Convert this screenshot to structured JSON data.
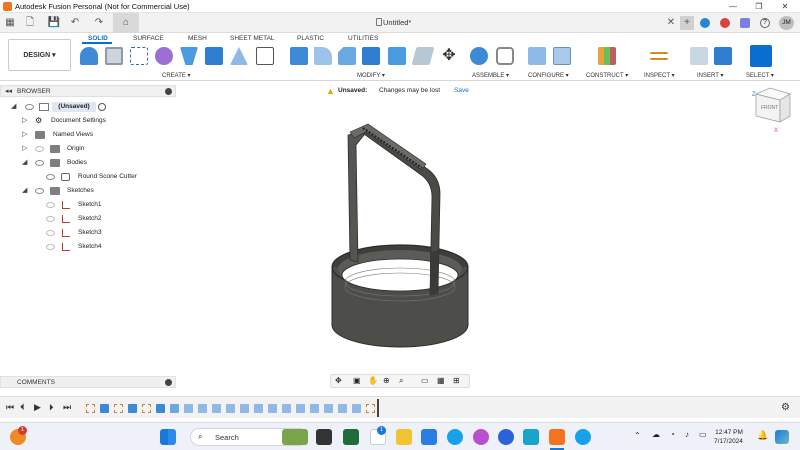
{
  "window": {
    "title": "Autodesk Fusion Personal (Not for Commercial Use)",
    "minimize": "—",
    "maximize": "❐",
    "close": "✕"
  },
  "qat": {
    "doc_title": "Untitled*"
  },
  "ribbon": {
    "design_label": "DESIGN ▾",
    "tabs": [
      "SOLID",
      "SURFACE",
      "MESH",
      "SHEET METAL",
      "PLASTIC",
      "UTILITIES"
    ],
    "groups": [
      "CREATE ▾",
      "MODIFY ▾",
      "ASSEMBLE ▾",
      "CONFIGURE ▾",
      "CONSTRUCT ▾",
      "INSPECT ▾",
      "INSERT ▾",
      "SELECT ▾"
    ]
  },
  "browser": {
    "title": "BROWSER",
    "root": "(Unsaved)",
    "items": [
      "Document Settings",
      "Named Views",
      "Origin",
      "Bodies",
      "Round Scone Cutter",
      "Sketches",
      "Sketch1",
      "Sketch2",
      "Sketch3",
      "Sketch4"
    ]
  },
  "notice": {
    "label": "Unsaved:",
    "message": "Changes may be lost",
    "action": "Save"
  },
  "viewcube": {
    "face": "FRONT"
  },
  "comments": {
    "title": "COMMENTS"
  },
  "taskbar": {
    "search_placeholder": "Search",
    "notification_count": "1",
    "time": "12:47 PM",
    "date": "7/17/2024"
  },
  "user": {
    "initials": "JM"
  },
  "colors": {
    "accent": "#0a6ed1",
    "body": "#4a4a46",
    "fusion_orange": "#f37321"
  }
}
